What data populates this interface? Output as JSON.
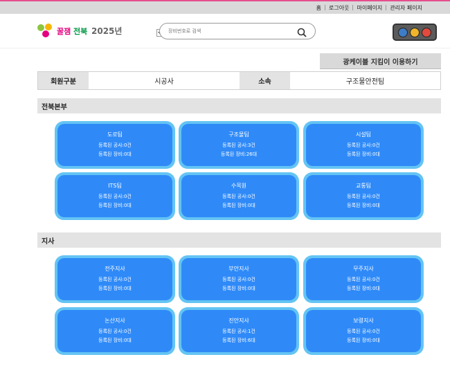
{
  "topnav": [
    "홈",
    "로그아웃",
    "마이페이지",
    "관리자 페이지"
  ],
  "logo": {
    "year": "2025년"
  },
  "search": {
    "placeholder": "장비번호로 검색"
  },
  "guide_button": "광케이블 지킴이 이용하기",
  "member_info": {
    "type_label": "회원구분",
    "type_value": "시공사",
    "affiliation_label": "소속",
    "affiliation_value": "구조물안전팀"
  },
  "sections": [
    {
      "title": "전북본부",
      "cards": [
        {
          "name": "도로팀",
          "projects": "등록된 공사:0건",
          "equipment": "등록된 장비:0대"
        },
        {
          "name": "구조물팀",
          "projects": "등록된 공사:3건",
          "equipment": "등록된 장비:26대"
        },
        {
          "name": "시설팀",
          "projects": "등록된 공사:0건",
          "equipment": "등록된 장비:0대"
        },
        {
          "name": "ITS팀",
          "projects": "등록된 공사:0건",
          "equipment": "등록된 장비:0대"
        },
        {
          "name": "수목원",
          "projects": "등록된 공사:0건",
          "equipment": "등록된 장비:0대"
        },
        {
          "name": "교통팀",
          "projects": "등록된 공사:0건",
          "equipment": "등록된 장비:0대"
        }
      ]
    },
    {
      "title": "지사",
      "cards": [
        {
          "name": "전주지사",
          "projects": "등록된 공사:0건",
          "equipment": "등록된 장비:0대"
        },
        {
          "name": "부안지사",
          "projects": "등록된 공사:0건",
          "equipment": "등록된 장비:0대"
        },
        {
          "name": "무주지사",
          "projects": "등록된 공사:0건",
          "equipment": "등록된 장비:0대"
        },
        {
          "name": "논산지사",
          "projects": "등록된 공사:0건",
          "equipment": "등록된 장비:0대"
        },
        {
          "name": "진안지사",
          "projects": "등록된 공사:1건",
          "equipment": "등록된 장비:6대"
        },
        {
          "name": "보령지사",
          "projects": "등록된 공사:0건",
          "equipment": "등록된 장비:0대"
        }
      ]
    }
  ],
  "colors": {
    "card_outer": "#64c4f3",
    "card_inner": "#2f8af8",
    "traffic_light": [
      "#3f7cc6",
      "#f0b52a",
      "#e24a3d"
    ]
  }
}
